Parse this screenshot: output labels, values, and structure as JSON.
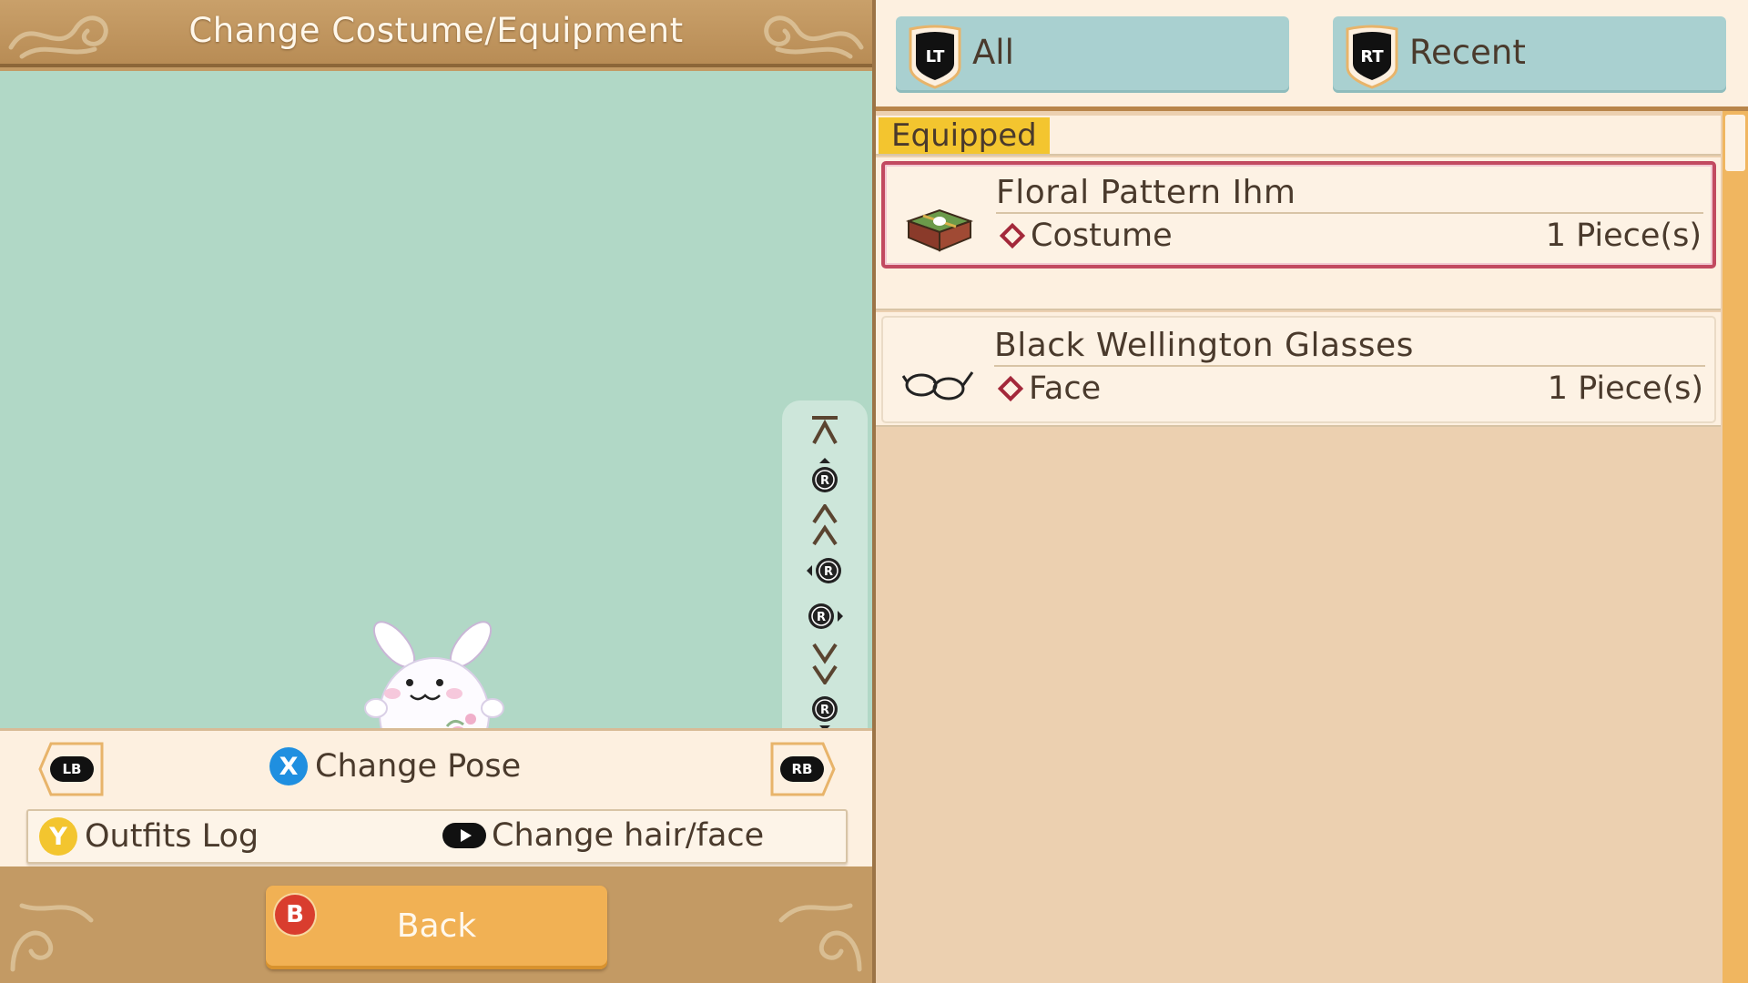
{
  "screen": {
    "title": "Change Costume/Equipment"
  },
  "camera_controls": [
    {
      "name": "camera-zoom-max-icon"
    },
    {
      "name": "camera-stick-up-icon"
    },
    {
      "name": "camera-zoom-in-icon"
    },
    {
      "name": "camera-rotate-left-icon"
    },
    {
      "name": "camera-rotate-right-icon"
    },
    {
      "name": "camera-zoom-out-icon"
    },
    {
      "name": "camera-stick-down-icon"
    },
    {
      "name": "camera-zoom-min-icon"
    }
  ],
  "controls": {
    "lb_label": "LB",
    "rb_label": "RB",
    "x_button": "X",
    "change_pose": "Change Pose",
    "y_button": "Y",
    "outfits_log": "Outfits Log",
    "change_hair_face": "Change hair/face"
  },
  "footer": {
    "b_button": "B",
    "back_label": "Back"
  },
  "tabs": [
    {
      "button": "LT",
      "label": "All"
    },
    {
      "button": "RT",
      "label": "Recent"
    }
  ],
  "list": {
    "section_label": "Equipped",
    "items": [
      {
        "name": "Floral Pattern Ihm",
        "type": "Costume",
        "count": "1 Piece(s)",
        "icon": "costume-box-icon",
        "selected": true
      },
      {
        "name": "Black Wellington Glasses",
        "type": "Face",
        "count": "1 Piece(s)",
        "icon": "glasses-icon",
        "selected": false
      }
    ]
  },
  "colors": {
    "viewport_bg": "#b1d8c6",
    "accent_selected": "#c24a60",
    "tab_bg": "#a9d0d0",
    "equipped_tag": "#f3c52f",
    "x_button": "#1f8fe0",
    "y_button": "#f3c52f",
    "b_button": "#d93d2e",
    "back_button": "#f1b154"
  }
}
